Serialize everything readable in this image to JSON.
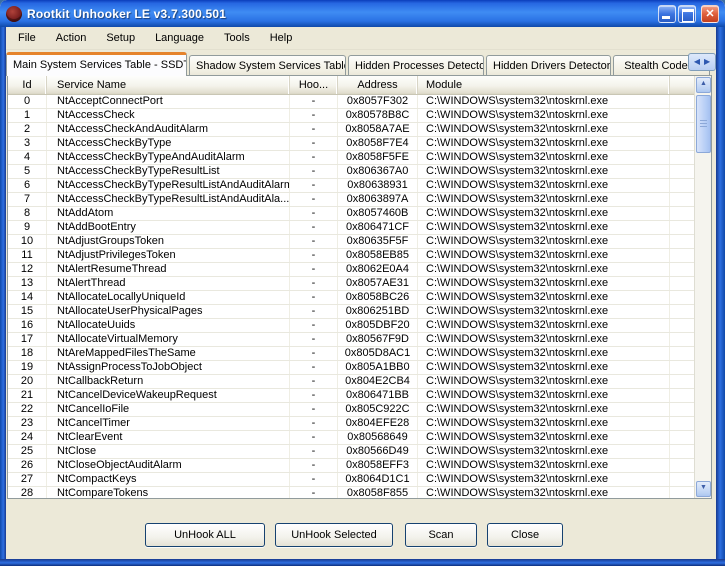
{
  "window": {
    "title": "Rootkit Unhooker LE v3.7.300.501"
  },
  "menu": {
    "items": [
      "File",
      "Action",
      "Setup",
      "Language",
      "Tools",
      "Help"
    ]
  },
  "tabs": {
    "items": [
      {
        "label": "Main System Services Table - SSDT",
        "active": true
      },
      {
        "label": "Shadow System Services Table",
        "active": false
      },
      {
        "label": "Hidden Processes Detector",
        "active": false
      },
      {
        "label": "Hidden Drivers Detector",
        "active": false
      },
      {
        "label": "Stealth Code D",
        "active": false
      }
    ]
  },
  "table": {
    "columns": [
      "Id",
      "Service Name",
      "Hoo...",
      "Address",
      "Module"
    ],
    "rows": [
      {
        "id": "0",
        "name": "NtAcceptConnectPort",
        "hooked": "-",
        "address": "0x8057F302",
        "module": "C:\\WINDOWS\\system32\\ntoskrnl.exe"
      },
      {
        "id": "1",
        "name": "NtAccessCheck",
        "hooked": "-",
        "address": "0x80578B8C",
        "module": "C:\\WINDOWS\\system32\\ntoskrnl.exe"
      },
      {
        "id": "2",
        "name": "NtAccessCheckAndAuditAlarm",
        "hooked": "-",
        "address": "0x8058A7AE",
        "module": "C:\\WINDOWS\\system32\\ntoskrnl.exe"
      },
      {
        "id": "3",
        "name": "NtAccessCheckByType",
        "hooked": "-",
        "address": "0x8058F7E4",
        "module": "C:\\WINDOWS\\system32\\ntoskrnl.exe"
      },
      {
        "id": "4",
        "name": "NtAccessCheckByTypeAndAuditAlarm",
        "hooked": "-",
        "address": "0x8058F5FE",
        "module": "C:\\WINDOWS\\system32\\ntoskrnl.exe"
      },
      {
        "id": "5",
        "name": "NtAccessCheckByTypeResultList",
        "hooked": "-",
        "address": "0x806367A0",
        "module": "C:\\WINDOWS\\system32\\ntoskrnl.exe"
      },
      {
        "id": "6",
        "name": "NtAccessCheckByTypeResultListAndAuditAlarm",
        "hooked": "-",
        "address": "0x80638931",
        "module": "C:\\WINDOWS\\system32\\ntoskrnl.exe"
      },
      {
        "id": "7",
        "name": "NtAccessCheckByTypeResultListAndAuditAla...",
        "hooked": "-",
        "address": "0x8063897A",
        "module": "C:\\WINDOWS\\system32\\ntoskrnl.exe"
      },
      {
        "id": "8",
        "name": "NtAddAtom",
        "hooked": "-",
        "address": "0x8057460B",
        "module": "C:\\WINDOWS\\system32\\ntoskrnl.exe"
      },
      {
        "id": "9",
        "name": "NtAddBootEntry",
        "hooked": "-",
        "address": "0x806471CF",
        "module": "C:\\WINDOWS\\system32\\ntoskrnl.exe"
      },
      {
        "id": "10",
        "name": "NtAdjustGroupsToken",
        "hooked": "-",
        "address": "0x80635F5F",
        "module": "C:\\WINDOWS\\system32\\ntoskrnl.exe"
      },
      {
        "id": "11",
        "name": "NtAdjustPrivilegesToken",
        "hooked": "-",
        "address": "0x8058EB85",
        "module": "C:\\WINDOWS\\system32\\ntoskrnl.exe"
      },
      {
        "id": "12",
        "name": "NtAlertResumeThread",
        "hooked": "-",
        "address": "0x8062E0A4",
        "module": "C:\\WINDOWS\\system32\\ntoskrnl.exe"
      },
      {
        "id": "13",
        "name": "NtAlertThread",
        "hooked": "-",
        "address": "0x8057AE31",
        "module": "C:\\WINDOWS\\system32\\ntoskrnl.exe"
      },
      {
        "id": "14",
        "name": "NtAllocateLocallyUniqueId",
        "hooked": "-",
        "address": "0x8058BC26",
        "module": "C:\\WINDOWS\\system32\\ntoskrnl.exe"
      },
      {
        "id": "15",
        "name": "NtAllocateUserPhysicalPages",
        "hooked": "-",
        "address": "0x806251BD",
        "module": "C:\\WINDOWS\\system32\\ntoskrnl.exe"
      },
      {
        "id": "16",
        "name": "NtAllocateUuids",
        "hooked": "-",
        "address": "0x805DBF20",
        "module": "C:\\WINDOWS\\system32\\ntoskrnl.exe"
      },
      {
        "id": "17",
        "name": "NtAllocateVirtualMemory",
        "hooked": "-",
        "address": "0x80567F9D",
        "module": "C:\\WINDOWS\\system32\\ntoskrnl.exe"
      },
      {
        "id": "18",
        "name": "NtAreMappedFilesTheSame",
        "hooked": "-",
        "address": "0x805D8AC1",
        "module": "C:\\WINDOWS\\system32\\ntoskrnl.exe"
      },
      {
        "id": "19",
        "name": "NtAssignProcessToJobObject",
        "hooked": "-",
        "address": "0x805A1BB0",
        "module": "C:\\WINDOWS\\system32\\ntoskrnl.exe"
      },
      {
        "id": "20",
        "name": "NtCallbackReturn",
        "hooked": "-",
        "address": "0x804E2CB4",
        "module": "C:\\WINDOWS\\system32\\ntoskrnl.exe"
      },
      {
        "id": "21",
        "name": "NtCancelDeviceWakeupRequest",
        "hooked": "-",
        "address": "0x806471BB",
        "module": "C:\\WINDOWS\\system32\\ntoskrnl.exe"
      },
      {
        "id": "22",
        "name": "NtCancelIoFile",
        "hooked": "-",
        "address": "0x805C922C",
        "module": "C:\\WINDOWS\\system32\\ntoskrnl.exe"
      },
      {
        "id": "23",
        "name": "NtCancelTimer",
        "hooked": "-",
        "address": "0x804EFE28",
        "module": "C:\\WINDOWS\\system32\\ntoskrnl.exe"
      },
      {
        "id": "24",
        "name": "NtClearEvent",
        "hooked": "-",
        "address": "0x80568649",
        "module": "C:\\WINDOWS\\system32\\ntoskrnl.exe"
      },
      {
        "id": "25",
        "name": "NtClose",
        "hooked": "-",
        "address": "0x80566D49",
        "module": "C:\\WINDOWS\\system32\\ntoskrnl.exe"
      },
      {
        "id": "26",
        "name": "NtCloseObjectAuditAlarm",
        "hooked": "-",
        "address": "0x8058EFF3",
        "module": "C:\\WINDOWS\\system32\\ntoskrnl.exe"
      },
      {
        "id": "27",
        "name": "NtCompactKeys",
        "hooked": "-",
        "address": "0x8064D1C1",
        "module": "C:\\WINDOWS\\system32\\ntoskrnl.exe"
      },
      {
        "id": "28",
        "name": "NtCompareTokens",
        "hooked": "-",
        "address": "0x8058F855",
        "module": "C:\\WINDOWS\\system32\\ntoskrnl.exe"
      }
    ]
  },
  "footer": {
    "buttons": [
      "UnHook ALL",
      "UnHook Selected",
      "Scan",
      "Close"
    ]
  },
  "colors": {
    "titlebar_blue": "#2a71e4",
    "window_chrome": "#ECE9D8",
    "active_tab_stripe": "#E5832C",
    "close_button_red": "#E0603C",
    "scrollbar_blue": "#B4CCF5"
  }
}
